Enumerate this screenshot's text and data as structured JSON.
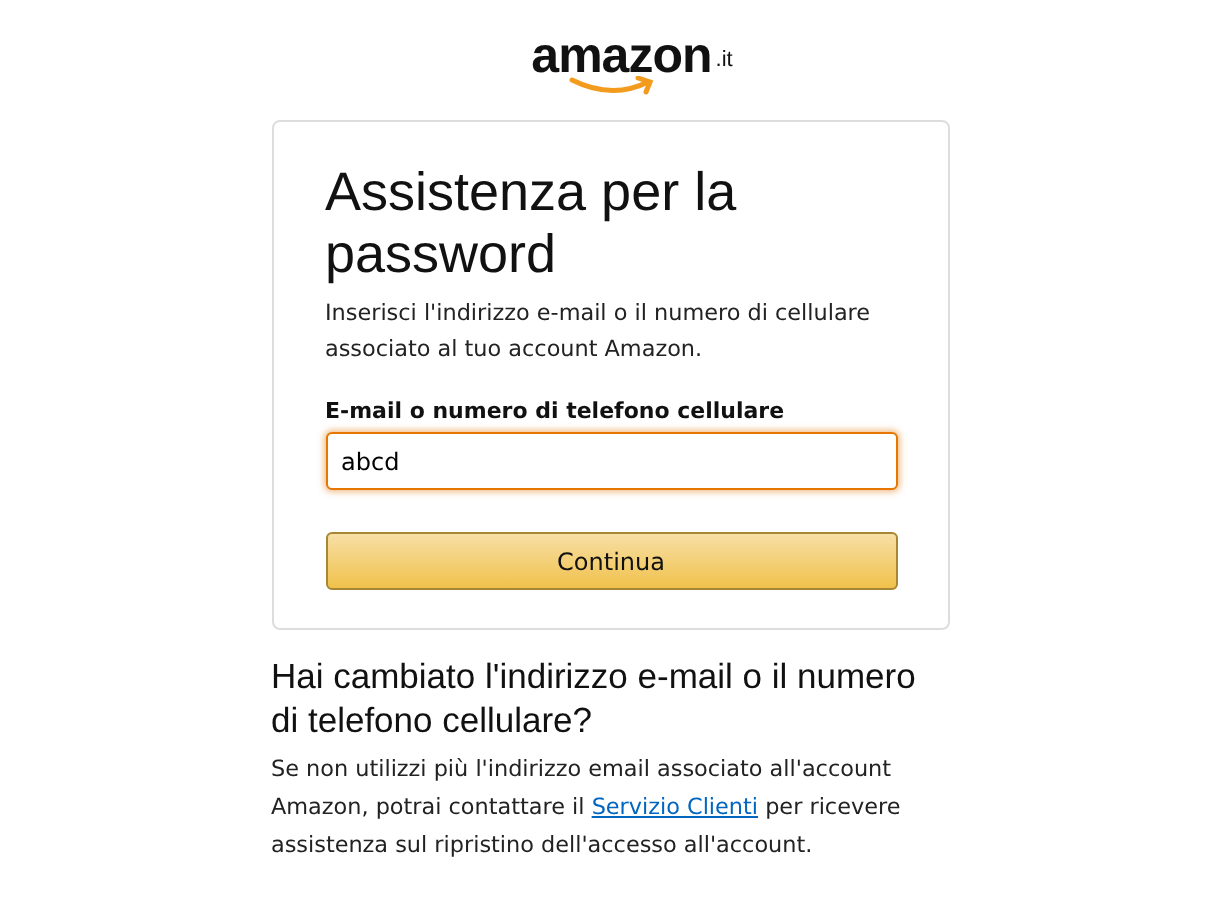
{
  "logo": {
    "name": "amazon",
    "domain": ".it"
  },
  "card": {
    "title": "Assistenza per la password",
    "description": "Inserisci l'indirizzo e-mail o il numero di cellulare associato al tuo account Amazon.",
    "field": {
      "label": "E-mail o numero di telefono cellulare",
      "value": "abcd",
      "focused": true
    },
    "button": "Continua"
  },
  "help": {
    "title": "Hai cambiato l'indirizzo e-mail o il numero di telefono cellulare?",
    "text_before": "Se non utilizzi più l'indirizzo email associato all'account Amazon, potrai contattare il",
    "link": "Servizio Clienti",
    "text_after": "per ricevere assistenza sul ripristino dell'accesso all'account."
  }
}
